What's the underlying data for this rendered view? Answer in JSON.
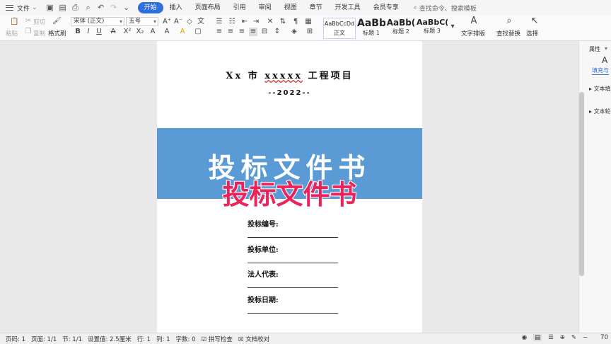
{
  "menu": {
    "file_label": "文件"
  },
  "tabs": [
    {
      "label": "开始",
      "active": true
    },
    {
      "label": "插入"
    },
    {
      "label": "页面布局"
    },
    {
      "label": "引用"
    },
    {
      "label": "审阅"
    },
    {
      "label": "视图"
    },
    {
      "label": "章节"
    },
    {
      "label": "开发工具"
    },
    {
      "label": "会员专享"
    }
  ],
  "search": {
    "placeholder": "查找命令、搜索模板"
  },
  "ribbon": {
    "cut": "剪切",
    "copy": "复制",
    "paste": "粘贴",
    "format_painter": "格式刷",
    "font_name": "宋体 (正文)",
    "font_size": "五号",
    "styles": [
      {
        "sample": "AaBbCcDd",
        "caption": "正文"
      },
      {
        "sample": "AaBb",
        "caption": "标题 1"
      },
      {
        "sample": "AaBb(",
        "caption": "标题 2"
      },
      {
        "sample": "AaBbC(",
        "caption": "标题 3"
      }
    ],
    "text_layout": "文字排版",
    "find_replace": "查找替换",
    "select": "选择"
  },
  "document": {
    "title_prefix": "Xx 市",
    "title_mid": "xxxxx",
    "title_suffix": "工程项目",
    "year": "--2022--",
    "banner_title": "投标文件书",
    "overlay_title": "投标文件书",
    "fields": [
      "投标编号:",
      "投标单位:",
      "法人代表:",
      "投标日期:"
    ]
  },
  "right_panel": {
    "header": "属性",
    "fill": "填充与",
    "item1": "文本填",
    "item2": "文本轮"
  },
  "status": {
    "page_code": "页码: 1",
    "pages": "页面: 1/1",
    "section": "节: 1/1",
    "setting": "设置值: 2.5厘米",
    "row": "行: 1",
    "col": "列: 1",
    "words": "字数: 0",
    "spell": "拼写检查",
    "proof": "文档校对",
    "zoom": "70"
  },
  "colors": {
    "accent": "#2e6fe0",
    "banner": "#5b9bd5",
    "overlay": "#e8245a"
  }
}
